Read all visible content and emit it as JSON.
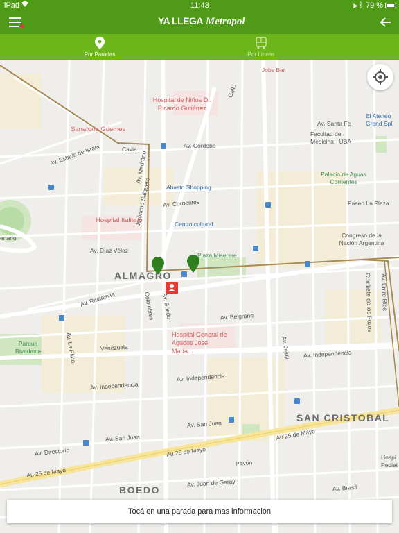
{
  "status_bar": {
    "carrier": "iPad",
    "time": "11:43",
    "battery": "79 %"
  },
  "app_bar": {
    "logo_text_1": "YA LLEGA",
    "logo_text_2": "Metropol"
  },
  "tabs": [
    {
      "label": "Por Paradas",
      "active": true
    },
    {
      "label": "Por Líneas",
      "active": false
    }
  ],
  "map": {
    "streets": {
      "av_cordoba": "Av. Córdoba",
      "av_corrientes": "Av. Corrientes",
      "av_diaz_velez": "Av. Díaz Vélez",
      "av_rivadavia": "Av. Rivadavia",
      "av_belgrano": "Av. Belgrano",
      "av_independencia_1": "Av. Independencia",
      "av_independencia_2": "Av. Independencia",
      "av_independencia_3": "Av. Independencia",
      "av_san_juan_1": "Av. San Juan",
      "av_san_juan_2": "Av. San Juan",
      "av_25_mayo_1": "Au 25 de Mayo",
      "av_25_mayo_2": "Au 25 de Mayo",
      "av_25_mayo_3": "Au 25 de Mayo",
      "av_boedo": "Av. Boedo",
      "colombres": "Colombres",
      "av_la_plata": "Av. La Plata",
      "av_directorio": "Av. Directorio",
      "venezuela": "Venezuela",
      "av_juan_de_garay": "Av. Juan de Garay",
      "av_santa_fe": "Av. Santa Fe",
      "av_jujuy": "Av. Jujuy",
      "pavon": "Pavón",
      "av_brasil": "Av. Brasil",
      "combate_pozos": "Combate de los Pozos",
      "av_entre_rios": "Av. Entre Ríos",
      "av_medrano": "Av. Medrano",
      "av_estado_israel": "Av. Estado de Israel",
      "cavia": "Cavia",
      "gallo": "Gallo",
      "guardia_vieja": "Jerónimo Salguero"
    },
    "pois": {
      "jobs_bar": "Jobs Bar",
      "hospital_ninos": "Hospital de Niños Dr. Ricardo Gutiérrez",
      "sanatorio_guemes": "Sanatorio Güemes",
      "facultad_medicina": "Facultad de Medicina - UBA",
      "el_ateneo": "El Ateneo Grand Spl",
      "palacio_aguas": "Palacio de Aguas Corrientes",
      "paseo_la_plaza": "Paseo La Plaza",
      "abasto": "Abasto Shopping",
      "hospital_italiano": "Hospital Italiano",
      "centro_cultural": "Centro cultural",
      "plaza_miserere": "Plaza Miserere",
      "congreso": "Congreso de la Nación Argentina",
      "hospital_general": "Hospital General de Agudos José María...",
      "parque_rivadavia": "Parque Rivadavia",
      "hospital_pediat": "Hospi Pediat",
      "enario": "enario"
    },
    "neighborhoods": {
      "almagro": "ALMAGRO",
      "san_cristobal": "SAN CRISTOBAL",
      "boedo": "BOEDO"
    }
  },
  "footer": {
    "info_text": "Tocá en una parada para mas información"
  },
  "colors": {
    "appbar": "#4f9a16",
    "tabs": "#6cb51b",
    "stop_pin": "#2e7d1f",
    "selected_pin": "#e53935"
  }
}
